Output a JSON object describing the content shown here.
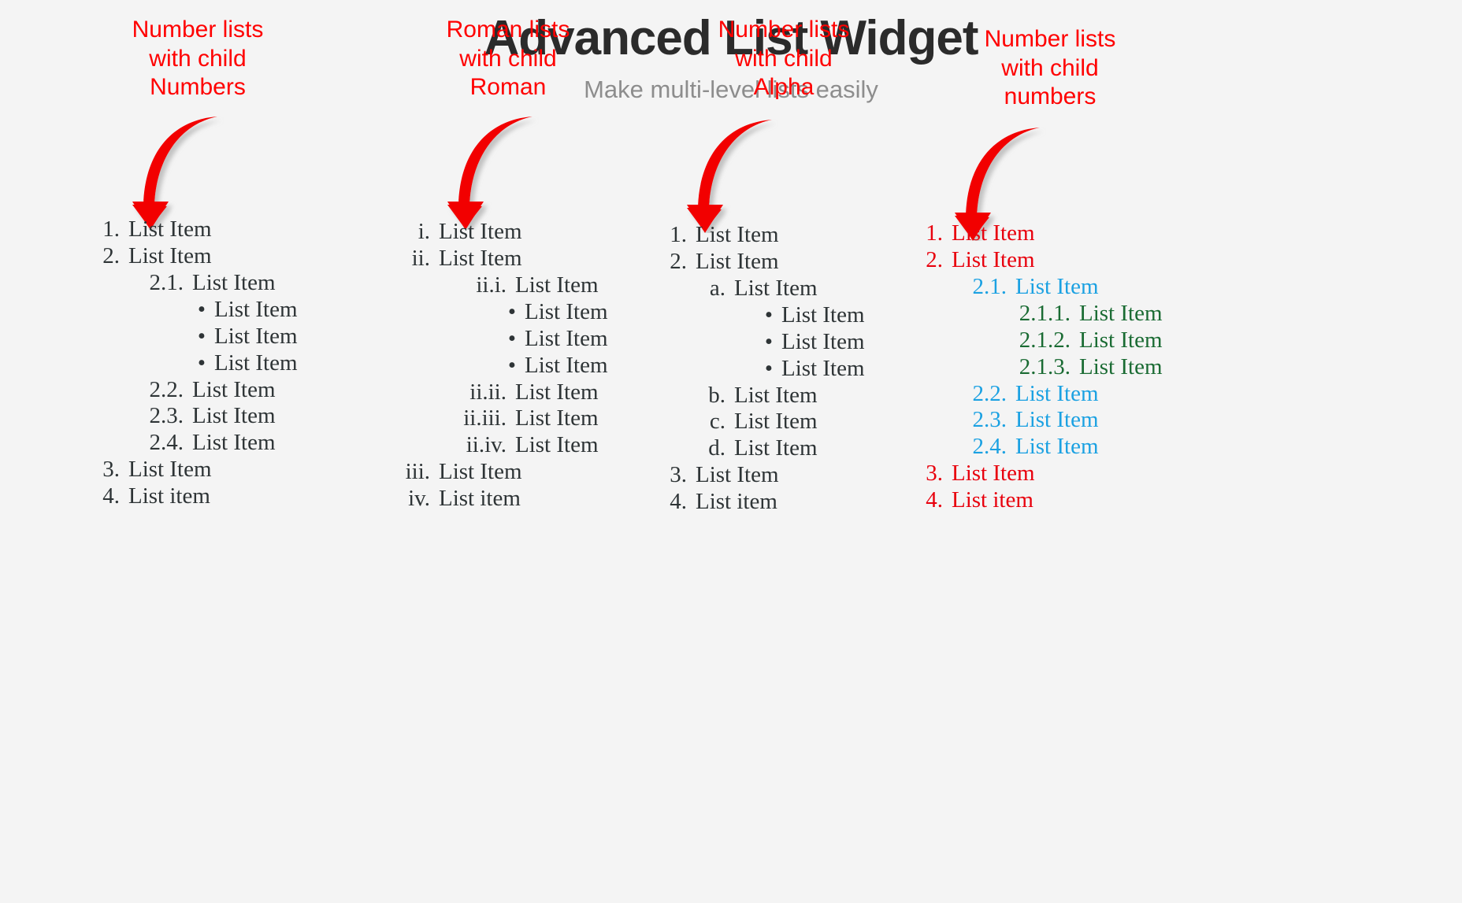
{
  "header": {
    "title": "Advanced List Widget",
    "subtitle": "Make multi-level lists easily"
  },
  "colors": {
    "background": "#f4f4f4",
    "title": "#2b2b2b",
    "subtitle": "#8d8d8d",
    "annotation_red": "#ff0000",
    "arrow_red": "#f20000",
    "list_default": "#2e3436",
    "level1_red": "#e8000d",
    "level2_blue": "#1ba1e2",
    "level3_green": "#1a6b33"
  },
  "columns": [
    {
      "annotation": "Number lists\nwith child\nNumbers",
      "arrow_icon": "curved-down-arrow-icon",
      "items": [
        {
          "marker": "1.",
          "text": "List Item",
          "level": 1
        },
        {
          "marker": "2.",
          "text": "List Item",
          "level": 1
        },
        {
          "marker": "2.1.",
          "text": "List Item",
          "level": 2
        },
        {
          "marker": "•",
          "text": "List Item",
          "level": 3
        },
        {
          "marker": "•",
          "text": "List Item",
          "level": 3
        },
        {
          "marker": "•",
          "text": "List Item",
          "level": 3
        },
        {
          "marker": "2.2.",
          "text": "List Item",
          "level": 2
        },
        {
          "marker": "2.3.",
          "text": "List Item",
          "level": 2
        },
        {
          "marker": "2.4.",
          "text": "List Item",
          "level": 2
        },
        {
          "marker": "3.",
          "text": "List Item",
          "level": 1
        },
        {
          "marker": "4.",
          "text": "List item",
          "level": 1
        }
      ]
    },
    {
      "annotation": "Roman lists\nwith child\nRoman",
      "arrow_icon": "curved-down-arrow-icon",
      "items": [
        {
          "marker": "i.",
          "text": "List Item",
          "level": 1
        },
        {
          "marker": "ii.",
          "text": "List Item",
          "level": 1
        },
        {
          "marker": "ii.i.",
          "text": "List Item",
          "level": 2
        },
        {
          "marker": "•",
          "text": "List Item",
          "level": 3
        },
        {
          "marker": "•",
          "text": "List Item",
          "level": 3
        },
        {
          "marker": "•",
          "text": "List Item",
          "level": 3
        },
        {
          "marker": "ii.ii.",
          "text": "List Item",
          "level": 2
        },
        {
          "marker": "ii.iii.",
          "text": "List Item",
          "level": 2
        },
        {
          "marker": "ii.iv.",
          "text": "List Item",
          "level": 2
        },
        {
          "marker": "iii.",
          "text": "List Item",
          "level": 1
        },
        {
          "marker": "iv.",
          "text": "List item",
          "level": 1
        }
      ]
    },
    {
      "annotation": "Number lists\nwith child\nAlpha",
      "arrow_icon": "curved-down-arrow-icon",
      "items": [
        {
          "marker": "1.",
          "text": "List Item",
          "level": 1
        },
        {
          "marker": "2.",
          "text": "List Item",
          "level": 1
        },
        {
          "marker": "a.",
          "text": "List Item",
          "level": 2
        },
        {
          "marker": "•",
          "text": "List Item",
          "level": 3
        },
        {
          "marker": "•",
          "text": "List Item",
          "level": 3
        },
        {
          "marker": "•",
          "text": "List Item",
          "level": 3
        },
        {
          "marker": "b.",
          "text": "List Item",
          "level": 2
        },
        {
          "marker": "c.",
          "text": "List Item",
          "level": 2
        },
        {
          "marker": "d.",
          "text": "List Item",
          "level": 2
        },
        {
          "marker": "3.",
          "text": "List Item",
          "level": 1
        },
        {
          "marker": "4.",
          "text": "List item",
          "level": 1
        }
      ]
    },
    {
      "annotation": "Number lists\nwith child\nnumbers",
      "arrow_icon": "curved-down-arrow-icon",
      "items": [
        {
          "marker": "1.",
          "text": "List Item",
          "level": 1,
          "color": "#e8000d"
        },
        {
          "marker": "2.",
          "text": "List Item",
          "level": 1,
          "color": "#e8000d"
        },
        {
          "marker": "2.1.",
          "text": "List Item",
          "level": 2,
          "color": "#1ba1e2"
        },
        {
          "marker": "2.1.1.",
          "text": "List Item",
          "level": 3,
          "color": "#1a6b33"
        },
        {
          "marker": "2.1.2.",
          "text": "List Item",
          "level": 3,
          "color": "#1a6b33"
        },
        {
          "marker": "2.1.3.",
          "text": "List Item",
          "level": 3,
          "color": "#1a6b33"
        },
        {
          "marker": "2.2.",
          "text": "List Item",
          "level": 2,
          "color": "#1ba1e2"
        },
        {
          "marker": "2.3.",
          "text": "List Item",
          "level": 2,
          "color": "#1ba1e2"
        },
        {
          "marker": "2.4.",
          "text": "List Item",
          "level": 2,
          "color": "#1ba1e2"
        },
        {
          "marker": "3.",
          "text": "List Item",
          "level": 1,
          "color": "#e8000d"
        },
        {
          "marker": "4.",
          "text": "List item",
          "level": 1,
          "color": "#e8000d"
        }
      ]
    }
  ]
}
